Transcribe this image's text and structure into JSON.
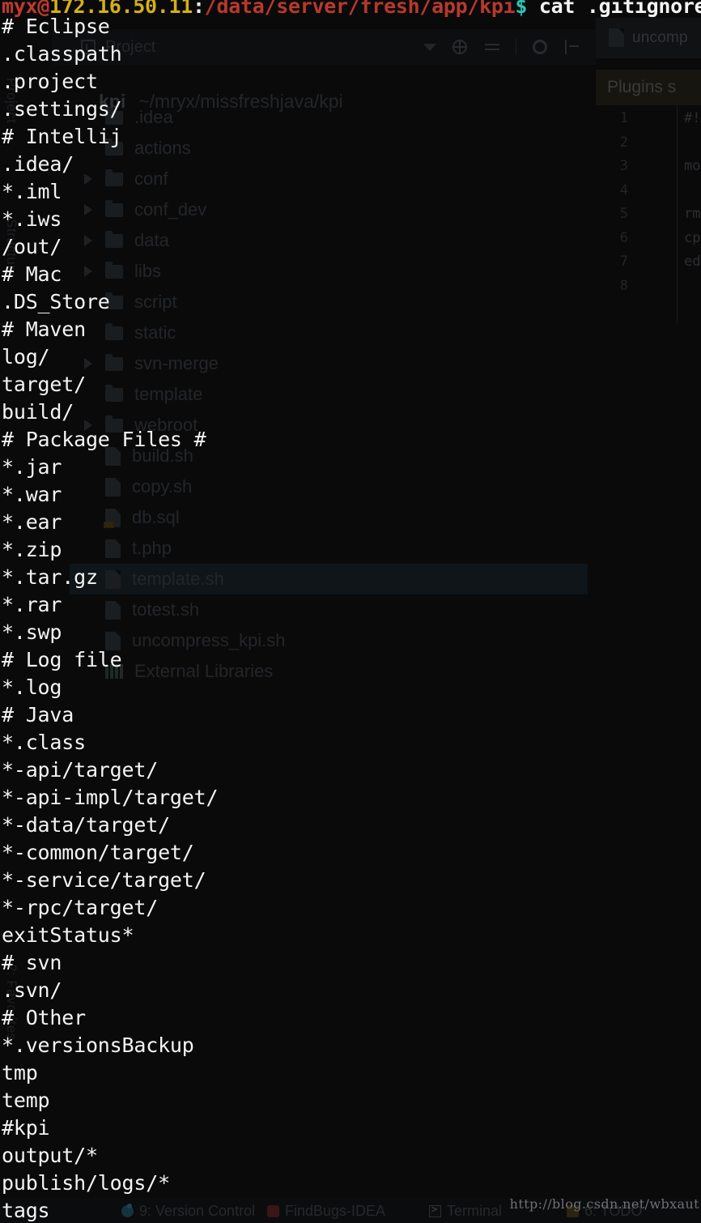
{
  "terminal": {
    "prompt": {
      "user": "myx@",
      "host": "172.16.50.11",
      "colon": ":",
      "path": "/data/server/fresh/app/kpi",
      "dollar": "$",
      "command": " cat .gitignore"
    },
    "gitignore_lines": [
      "# Eclipse",
      ".classpath",
      ".project",
      ".settings/",
      "# Intellij",
      ".idea/",
      "*.iml",
      "*.iws",
      "/out/",
      "# Mac",
      ".DS_Store",
      "# Maven",
      "log/",
      "target/",
      "build/",
      "# Package Files #",
      "*.jar",
      "*.war",
      "*.ear",
      "*.zip",
      "*.tar.gz",
      "*.rar",
      "*.swp",
      "# Log file",
      "*.log",
      "# Java",
      "*.class",
      "*-api/target/",
      "*-api-impl/target/",
      "*-data/target/",
      "*-common/target/",
      "*-service/target/",
      "*-rpc/target/",
      "exitStatus*",
      "# svn",
      ".svn/",
      "# Other",
      "*.versionsBackup",
      "tmp",
      "temp",
      "#kpi",
      "output/*",
      "publish/logs/*",
      "tags"
    ]
  },
  "watermark": "http://blog.csdn.net/wbxaut",
  "ide": {
    "editor_tab": "uncomp",
    "notification": "Plugins s",
    "gutter_lines": [
      "1",
      "2",
      "3",
      "4",
      "5",
      "6",
      "7",
      "8"
    ],
    "code_preview": "#!\n\nmo\n\nrm\ncp\ned",
    "project_panel": {
      "title": "Project",
      "root_name": "kpi",
      "root_path": "~/mryx/missfreshjava/kpi"
    },
    "side_tabs": [
      "Project",
      "Structure",
      "2: Favorites"
    ],
    "tree": [
      {
        "label": ".idea",
        "kind": "folder",
        "arrow": false,
        "selected": false
      },
      {
        "label": "actions",
        "kind": "folder",
        "arrow": false,
        "selected": false
      },
      {
        "label": "conf",
        "kind": "folder",
        "arrow": true,
        "selected": false
      },
      {
        "label": "conf_dev",
        "kind": "folder",
        "arrow": true,
        "selected": false
      },
      {
        "label": "data",
        "kind": "folder",
        "arrow": true,
        "selected": false
      },
      {
        "label": "libs",
        "kind": "folder",
        "arrow": true,
        "selected": false
      },
      {
        "label": "script",
        "kind": "folder",
        "arrow": false,
        "selected": false
      },
      {
        "label": "static",
        "kind": "folder",
        "arrow": false,
        "selected": false
      },
      {
        "label": "svn-merge",
        "kind": "folder",
        "arrow": true,
        "selected": false
      },
      {
        "label": "template",
        "kind": "folder",
        "arrow": false,
        "selected": false
      },
      {
        "label": "webroot",
        "kind": "folder",
        "arrow": true,
        "selected": false
      },
      {
        "label": "build.sh",
        "kind": "file",
        "arrow": false,
        "selected": false
      },
      {
        "label": "copy.sh",
        "kind": "file",
        "arrow": false,
        "selected": false
      },
      {
        "label": "db.sql",
        "kind": "sql",
        "arrow": false,
        "selected": false
      },
      {
        "label": "t.php",
        "kind": "file",
        "arrow": false,
        "selected": false
      },
      {
        "label": "template.sh",
        "kind": "file",
        "arrow": false,
        "selected": true
      },
      {
        "label": "totest.sh",
        "kind": "file",
        "arrow": false,
        "selected": false
      },
      {
        "label": "uncompress_kpi.sh",
        "kind": "file",
        "arrow": false,
        "selected": false
      },
      {
        "label": "External Libraries",
        "kind": "lib",
        "arrow": false,
        "selected": false
      }
    ],
    "statusbar": [
      {
        "label": "9: Version Control",
        "icon": "vcs"
      },
      {
        "label": "FindBugs-IDEA",
        "icon": "bug"
      },
      {
        "label": "Terminal",
        "icon": "term"
      },
      {
        "label": "6: TODO",
        "icon": "todo"
      }
    ]
  }
}
